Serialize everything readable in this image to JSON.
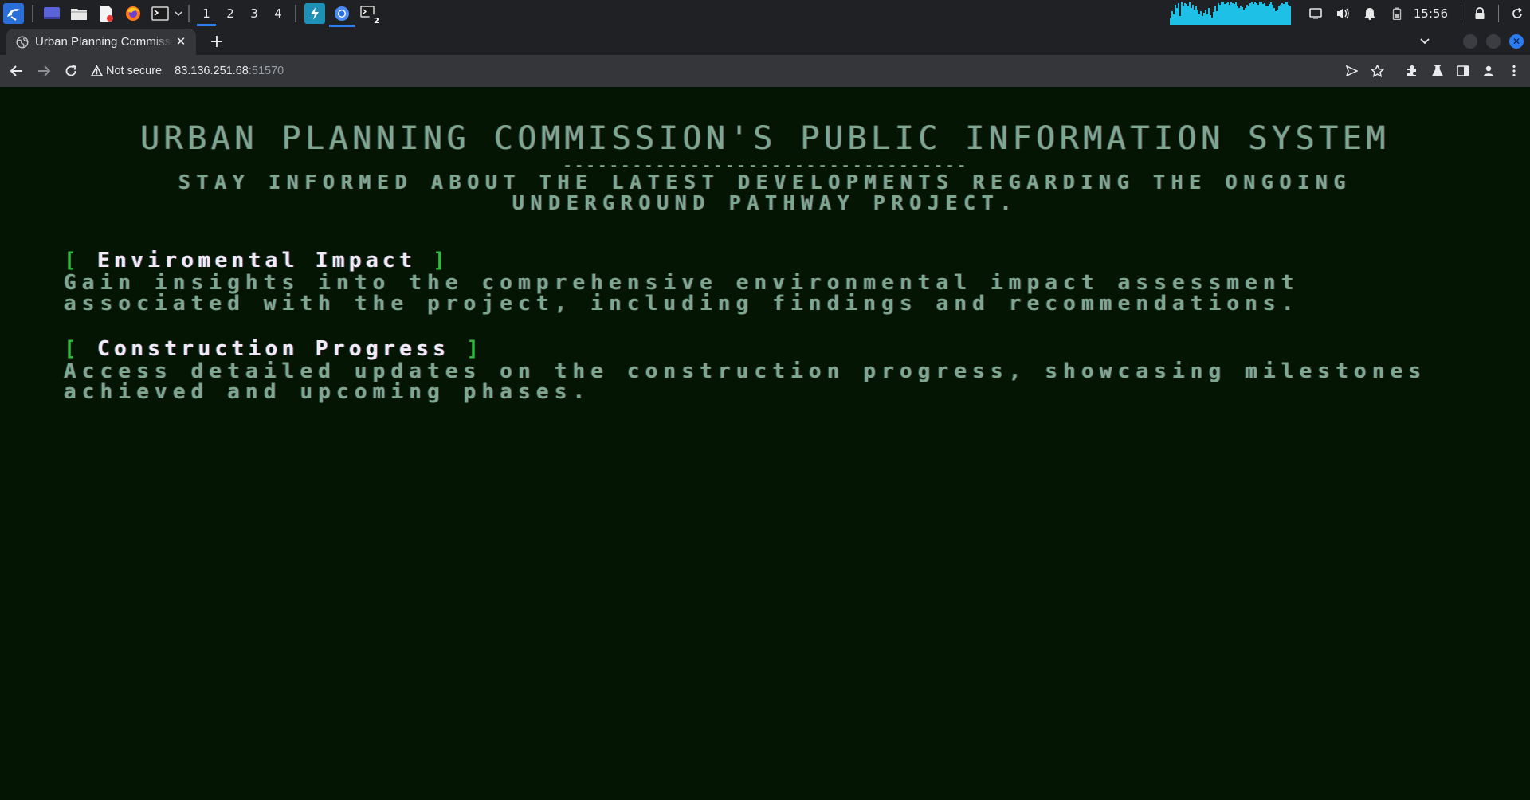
{
  "taskbar": {
    "workspaces": [
      "1",
      "2",
      "3",
      "4"
    ],
    "active_workspace": "1",
    "clock": "15:56",
    "badge_count": "2",
    "apps": [
      "kali-menu-icon",
      "desktop-icon",
      "files-icon",
      "text-editor-icon",
      "firefox-icon",
      "terminal-icon",
      "terminal-dropdown-icon"
    ],
    "pinned": [
      "burp-icon",
      "chromium-icon",
      "terminal-icon"
    ],
    "tray": [
      "display-icon",
      "volume-icon",
      "notifications-icon",
      "battery-icon",
      "lock-icon",
      "refresh-icon"
    ],
    "accent_color": "#2f7ef0",
    "graph_color": "#1ec0e6"
  },
  "browser": {
    "tab_title": "Urban Planning Commission's Public Information System",
    "new_tab_label": "+",
    "security_label": "Not secure",
    "url_host": "83.136.251.68",
    "url_port": ":51570"
  },
  "page": {
    "title": "URBAN PLANNING COMMISSION'S PUBLIC INFORMATION SYSTEM",
    "divider": "-----------------------------------",
    "subtitle": "STAY INFORMED ABOUT THE LATEST DEVELOPMENTS REGARDING THE ONGOING UNDERGROUND PATHWAY PROJECT.",
    "sections": [
      {
        "bracket_open": "[",
        "heading": "Enviromental Impact",
        "bracket_close": "]",
        "text": "Gain insights into the comprehensive environmental impact assessment associated with the project, including findings and recommendations."
      },
      {
        "bracket_open": "[",
        "heading": "Construction Progress",
        "bracket_close": "]",
        "text": "Access detailed updates on the construction progress, showcasing milestones achieved and upcoming phases."
      }
    ],
    "colors": {
      "background": "#041504",
      "text": "#7fa68e",
      "heading": "#f0ebf4",
      "bracket": "#2fbd3b"
    }
  }
}
